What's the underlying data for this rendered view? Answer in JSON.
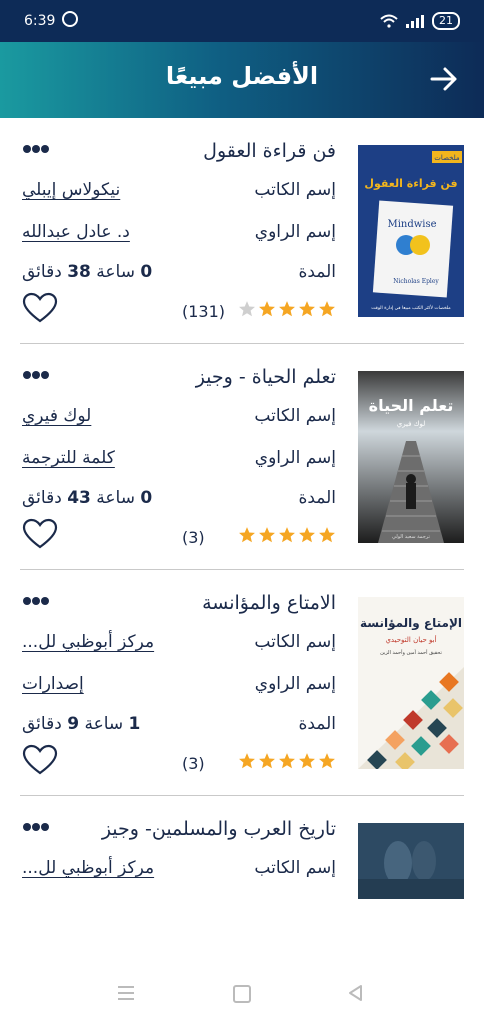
{
  "status": {
    "time": "6:39",
    "battery": "21"
  },
  "header": {
    "title": "الأفضل مبيعًا"
  },
  "labels": {
    "author": "إسم الكاتب",
    "narrator": "إسم الراوي",
    "duration": "المدة",
    "hours_unit": "ساعة",
    "minutes_unit": "دقائق"
  },
  "books": [
    {
      "title": "فن قراءة العقول",
      "author": "نيكولاس إيبلي",
      "narrator": "د. عادل عبدالله",
      "duration_hours": "0",
      "duration_minutes": "38",
      "rating": 4,
      "rating_count": "(131)",
      "cover": {
        "tag": "ملخصات",
        "title": "فن قراءة العقول",
        "book_en": "Mindwise",
        "author_en": "Nicholas Epley",
        "footer": "ملخصات لأكثر الكتب مبيعا في إدارة الوقت"
      }
    },
    {
      "title": "تعلم الحياة - وجيز",
      "author": "لوك فيري",
      "narrator": "كلمة للترجمة",
      "duration_hours": "0",
      "duration_minutes": "43",
      "rating": 5,
      "rating_count": "(3)",
      "cover": {
        "title": "تعلم الحياة",
        "subtitle": "لوك فيري",
        "footer": "ترجمة سعيد الولي"
      }
    },
    {
      "title": "الامتاع والمؤانسة",
      "author": "مركز أبوظبي لل...",
      "narrator": "إصدارات",
      "duration_hours": "1",
      "duration_minutes": "9",
      "rating": 5,
      "rating_count": "(3)",
      "cover": {
        "title": "الإمتاع والمؤانسة",
        "subtitle": "أبو حيان التوحيدي",
        "note": "تحقيق أحمد أمين وأحمد الزين"
      }
    },
    {
      "title": "تاريخ العرب والمسلمين- وجيز",
      "author": "مركز أبوظبي لل..."
    }
  ],
  "colors": {
    "header_dark": "#0d2b57",
    "header_teal": "#1a9aa0",
    "star": "#f5a623",
    "star_empty": "#cfcfcf"
  }
}
